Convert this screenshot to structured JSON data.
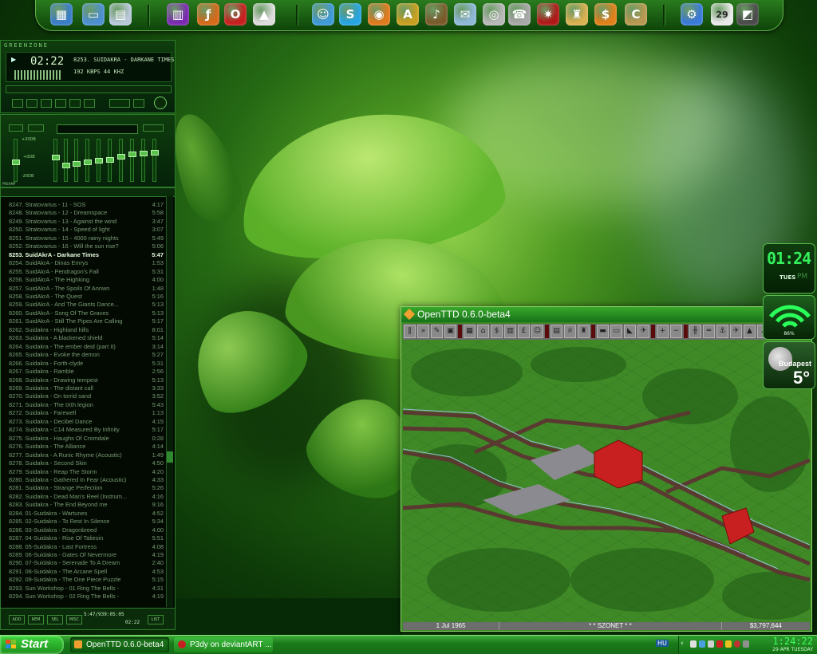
{
  "dock": {
    "icons": [
      {
        "name": "desktop-icon",
        "glyph": "▦",
        "color": "#3a7dc8"
      },
      {
        "name": "monitor-icon",
        "glyph": "▭",
        "color": "#4d8fd0"
      },
      {
        "name": "documents-icon",
        "glyph": "▤",
        "color": "#b8c8d8"
      },
      {
        "name": "winrar-icon",
        "glyph": "▥",
        "color": "#7a2ab0"
      },
      {
        "name": "flash-icon",
        "glyph": "ƒ",
        "color": "#d46a1a"
      },
      {
        "name": "opera-icon",
        "glyph": "O",
        "color": "#c81e1e"
      },
      {
        "name": "arrow-app-icon",
        "glyph": "▲",
        "color": "#dcdcdc"
      },
      {
        "name": "messenger-icon",
        "glyph": "☺",
        "color": "#3f9ad8"
      },
      {
        "name": "skype-icon",
        "glyph": "S",
        "color": "#27a5e2"
      },
      {
        "name": "firefox-icon",
        "glyph": "◉",
        "color": "#e07a1e"
      },
      {
        "name": "acrobat-icon",
        "glyph": "A",
        "color": "#c8a020"
      },
      {
        "name": "guitar-icon",
        "glyph": "♪",
        "color": "#7a5a2a"
      },
      {
        "name": "mail-icon",
        "glyph": "✉",
        "color": "#8fb8d8"
      },
      {
        "name": "webcam-icon",
        "glyph": "◎",
        "color": "#b8b8b8"
      },
      {
        "name": "phone-icon",
        "glyph": "☎",
        "color": "#a8a8a8"
      },
      {
        "name": "dragon-icon",
        "glyph": "✷",
        "color": "#b01818"
      },
      {
        "name": "game-icon",
        "glyph": "♜",
        "color": "#d8b050"
      },
      {
        "name": "money-icon",
        "glyph": "$",
        "color": "#e0801a"
      },
      {
        "name": "civ-icon",
        "glyph": "C",
        "color": "#b89850"
      },
      {
        "name": "tools-icon",
        "glyph": "⚙",
        "color": "#3a7ad8"
      },
      {
        "name": "calendar-icon",
        "glyph": "29",
        "color": "#e8e8e8"
      },
      {
        "name": "terminal-icon",
        "glyph": "◩",
        "color": "#4a4a4a"
      }
    ]
  },
  "winamp": {
    "title": "GREENZONE",
    "time": "02:22",
    "track": "8253. SUIDAKRA - DARKANE TIMES",
    "bitrate": "192 KBPS 44 KHZ",
    "eq_labels": [
      "+20DB",
      "+0DB",
      "-20DB"
    ],
    "preamp_label": "PREAMP",
    "eq_bands": [
      0.55,
      0.42,
      0.62,
      0.58,
      0.55,
      0.5,
      0.48,
      0.4,
      0.32,
      0.3,
      0.28
    ],
    "eq_band_labels": [
      "60",
      "170",
      "310",
      "600",
      "1K",
      "3K",
      "6K",
      "12K",
      "14K",
      "16K"
    ]
  },
  "playlist": {
    "active_index": 6,
    "tracks": [
      {
        "title": "8247. Stratovarius - 11 - SOS",
        "len": "4:17"
      },
      {
        "title": "8248. Stratovarius - 12 - Dreamspace",
        "len": "5:58"
      },
      {
        "title": "8249. Stratovarius - 13 - Against the wind",
        "len": "3:47"
      },
      {
        "title": "8250. Stratovarius - 14 - Speed of light",
        "len": "3:07"
      },
      {
        "title": "8251. Stratovarius - 15 - 4000 rainy nights",
        "len": "5:49"
      },
      {
        "title": "8252. Stratovarius - 16 - Will the sun rise?",
        "len": "5:06"
      },
      {
        "title": "8253. SuidAkrA - Darkane Times",
        "len": "5:47"
      },
      {
        "title": "8254. SuidAkrA - Dinas Emrys",
        "len": "1:53"
      },
      {
        "title": "8255. SuidAkrA - Pendragon's Fall",
        "len": "5:31"
      },
      {
        "title": "8256. SuidAkrA - The Highking",
        "len": "4:00"
      },
      {
        "title": "8257. SuidAkrA - The Spoils Of Annwn",
        "len": "1:48"
      },
      {
        "title": "8258. SuidAkrA - The Quest",
        "len": "5:16"
      },
      {
        "title": "8259. SuidAkrA - And The Giants Dance...",
        "len": "5:13"
      },
      {
        "title": "8260. SuidAkrA - Song Of The Graves",
        "len": "5:13"
      },
      {
        "title": "8261. SuidAkrA - Still The Pipes Are Calling",
        "len": "5:17"
      },
      {
        "title": "8262. Suidakra - Highland hills",
        "len": "8:01"
      },
      {
        "title": "8263. Suidakra - A blackened shield",
        "len": "5:14"
      },
      {
        "title": "8264. Suidakra - The ember deid (part II)",
        "len": "3:14"
      },
      {
        "title": "8265. Suidakra - Evoke the demon",
        "len": "5:27"
      },
      {
        "title": "8266. Suidakra - Forth-clyde",
        "len": "5:31"
      },
      {
        "title": "8267. Suidakra - Ramble",
        "len": "2:56"
      },
      {
        "title": "8268. Suidakra - Drawing tempest",
        "len": "5:13"
      },
      {
        "title": "8269. Suidakra - The distant call",
        "len": "3:33"
      },
      {
        "title": "8270. Suidakra - On torrid sand",
        "len": "3:52"
      },
      {
        "title": "8271. Suidakra - The IXth legion",
        "len": "5:43"
      },
      {
        "title": "8272. Suidakra - Farewell",
        "len": "1:13"
      },
      {
        "title": "8273. Suidakra - Decibel Dance",
        "len": "4:15"
      },
      {
        "title": "8274. Suidakra - C14 Measured By Infinity",
        "len": "5:17"
      },
      {
        "title": "8275. Suidakra - Haughs Of Cromdale",
        "len": "0:28"
      },
      {
        "title": "8276. Suidakra - The Alliance",
        "len": "4:14"
      },
      {
        "title": "8277. Suidakra - A Runic Rhyme (Acoustic)",
        "len": "1:49"
      },
      {
        "title": "8278. Suidakra - Second Skin",
        "len": "4:50"
      },
      {
        "title": "8279. Suidakra - Reap The Storm",
        "len": "4:20"
      },
      {
        "title": "8280. Suidakra - Gathered In Fear (Acoustic)",
        "len": "4:33"
      },
      {
        "title": "8281. Suidakra - Strange Perfection",
        "len": "5:26"
      },
      {
        "title": "8282. Suidakra - Dead Man's Reel (Instrum...",
        "len": "4:16"
      },
      {
        "title": "8283. Suidakra - The End Beyond me",
        "len": "9:16"
      },
      {
        "title": "8284. 01-Suidakra - Wartunes",
        "len": "4:52"
      },
      {
        "title": "8285. 02-Suidakra - To Rest In Silence",
        "len": "5:34"
      },
      {
        "title": "8286. 03-Suidakra - Dragonbreed",
        "len": "4:00"
      },
      {
        "title": "8287. 04-Suidakra - Rise Of Taliesin",
        "len": "5:51"
      },
      {
        "title": "8288. 05-Suidakra - Last Fortress",
        "len": "4:08"
      },
      {
        "title": "8289. 06-Suidakra - Gates Of Nevermore",
        "len": "4:19"
      },
      {
        "title": "8290. 07-Suidakra - Serenade To A Dream",
        "len": "2:40"
      },
      {
        "title": "8291. 08-Suidakra - The Arcane Spell",
        "len": "4:53"
      },
      {
        "title": "8292. 09-Suidakra - The One Piece Puzzle",
        "len": "5:15"
      },
      {
        "title": "8293. Sun Workshop - 01 Ring The Bells -",
        "len": "4:31"
      },
      {
        "title": "8294. Sun Workshop - 02 Ring The Bells -",
        "len": "4:19"
      }
    ],
    "footer_buttons": [
      "ADD",
      "REM",
      "SEL",
      "MISC",
      "LIST"
    ],
    "footer_time": "5:47/939:05:05",
    "footer_time2": "02:22"
  },
  "openttd": {
    "title": "OpenTTD 0.6.0-beta4",
    "status_date": "1 Jul 1965",
    "status_news": "* * SZONET * *",
    "status_money": "$3,797,644"
  },
  "gadgets": {
    "clock_time": "01:24",
    "clock_day": "TUES",
    "clock_ampm": "PM",
    "wifi_percent": "86%",
    "weather_city": "Budapest",
    "weather_temp": "5°"
  },
  "taskbar": {
    "start_label": "Start",
    "tasks": [
      {
        "name": "task-openttd",
        "label": "OpenTTD 0.6.0-beta4"
      },
      {
        "name": "task-browser",
        "label": "P3dy on deviantART ..."
      }
    ],
    "tray_lang": "HU",
    "tray_time": "1:24:22",
    "tray_date": "29 APR TUESDAY"
  }
}
